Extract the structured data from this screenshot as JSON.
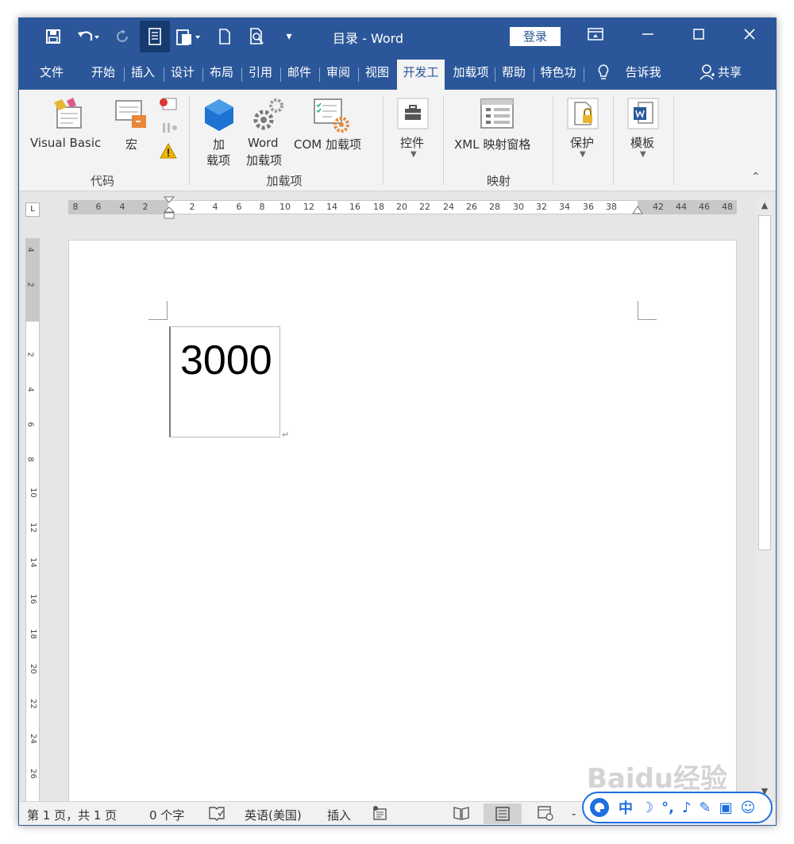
{
  "window": {
    "title": "目录 - Word",
    "login_label": "登录",
    "controls": [
      "▭",
      "—",
      "☐",
      "✕"
    ]
  },
  "quick_access": {
    "save_icon": "save-icon",
    "undo_icon": "undo-icon",
    "redo_icon": "redo-icon",
    "paste_icon": "paste-icon",
    "new_icon": "new-document-icon",
    "preview_icon": "print-preview-icon",
    "customize_glyph": "▾"
  },
  "tabs": [
    {
      "label": "文件"
    },
    {
      "label": "开始"
    },
    {
      "label": "插入"
    },
    {
      "label": "设计"
    },
    {
      "label": "布局"
    },
    {
      "label": "引用"
    },
    {
      "label": "邮件"
    },
    {
      "label": "审阅"
    },
    {
      "label": "视图"
    },
    {
      "label": "开发工",
      "active": true
    },
    {
      "label": "加载项"
    },
    {
      "label": "帮助"
    },
    {
      "label": "特色功"
    },
    {
      "label": "告诉我"
    },
    {
      "label": "共享"
    }
  ],
  "ribbon": {
    "visual_basic": "Visual Basic",
    "macro": "宏",
    "addin_line1": "加",
    "addin_line2": "载项",
    "word_addin_line1": "Word",
    "word_addin_line2": "加载项",
    "com_addin": "COM 加载项",
    "controls": "控件",
    "xml_pane": "XML 映射窗格",
    "protect": "保护",
    "template": "模板",
    "groups": {
      "code": "代码",
      "addins": "加载项",
      "mapping": "映射"
    }
  },
  "ruler": {
    "tab_selector": "L",
    "h_numbers": [
      "8",
      "6",
      "4",
      "2",
      "2",
      "4",
      "6",
      "8",
      "10",
      "12",
      "14",
      "16",
      "18",
      "20",
      "22",
      "24",
      "26",
      "28",
      "30",
      "32",
      "34",
      "36",
      "38",
      "42",
      "44",
      "46",
      "48"
    ],
    "v_numbers": [
      "4",
      "2",
      "2",
      "4",
      "6",
      "8",
      "10",
      "12",
      "14",
      "16",
      "18",
      "20",
      "22",
      "24",
      "26"
    ]
  },
  "document": {
    "textbox_text": "3000",
    "paragraph_mark": "↵"
  },
  "status": {
    "page_info": "第 1 页，共 1 页",
    "word_count": "0 个字",
    "language": "英语(美国)",
    "insert_mode": "插入",
    "zoom_minus": "-"
  },
  "overlay": {
    "watermark": "Baidu经验",
    "ime_label": "中"
  }
}
